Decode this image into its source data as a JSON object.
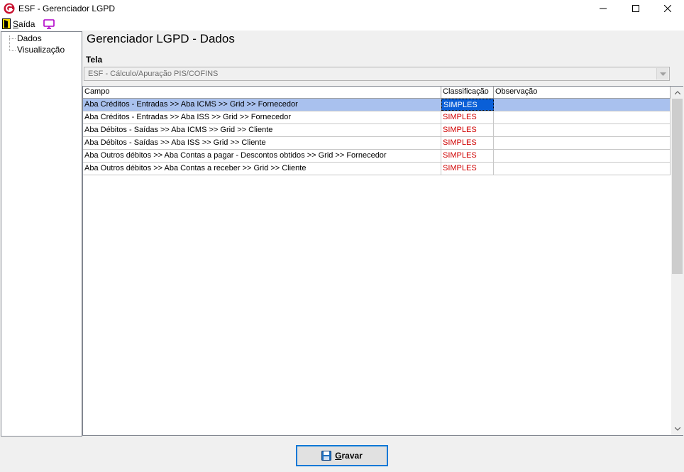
{
  "window": {
    "title": "ESF - Gerenciador LGPD",
    "controls": {
      "minimize": "–",
      "maximize": "☐",
      "close": "✕"
    }
  },
  "menu": {
    "exit_label_first": "S",
    "exit_label_rest": "aída",
    "icons": [
      "exit-door-icon",
      "monitor-icon"
    ]
  },
  "tree": {
    "items": [
      {
        "label": "Dados"
      },
      {
        "label": "Visualização"
      }
    ]
  },
  "main": {
    "title": "Gerenciador LGPD - Dados",
    "screen_label": "Tela",
    "screen_value": "ESF - Cálculo/Apuração PIS/COFINS"
  },
  "grid": {
    "columns": [
      "Campo",
      "Classificação",
      "Observação"
    ],
    "rows": [
      {
        "campo": "Aba Créditos - Entradas >> Aba ICMS >> Grid >> Fornecedor",
        "classificacao": "SIMPLES",
        "observacao": "",
        "selected": true
      },
      {
        "campo": "Aba Créditos - Entradas >> Aba ISS >> Grid >> Fornecedor",
        "classificacao": "SIMPLES",
        "observacao": ""
      },
      {
        "campo": "Aba Débitos - Saídas >> Aba ICMS >> Grid >> Cliente",
        "classificacao": "SIMPLES",
        "observacao": ""
      },
      {
        "campo": "Aba Débitos - Saídas >> Aba ISS >> Grid >> Cliente",
        "classificacao": "SIMPLES",
        "observacao": ""
      },
      {
        "campo": "Aba Outros débitos >> Aba Contas a pagar - Descontos obtidos >> Grid >> Fornecedor",
        "classificacao": "SIMPLES",
        "observacao": ""
      },
      {
        "campo": "Aba Outros débitos >> Aba Contas a receber >> Grid >> Cliente",
        "classificacao": "SIMPLES",
        "observacao": ""
      }
    ]
  },
  "footer": {
    "save_first": "G",
    "save_rest": "ravar"
  },
  "colors": {
    "selection": "#a9c1ee",
    "selected_cell": "#0a5fd7",
    "classification_text": "#d00000",
    "focus_border": "#0078d7"
  }
}
